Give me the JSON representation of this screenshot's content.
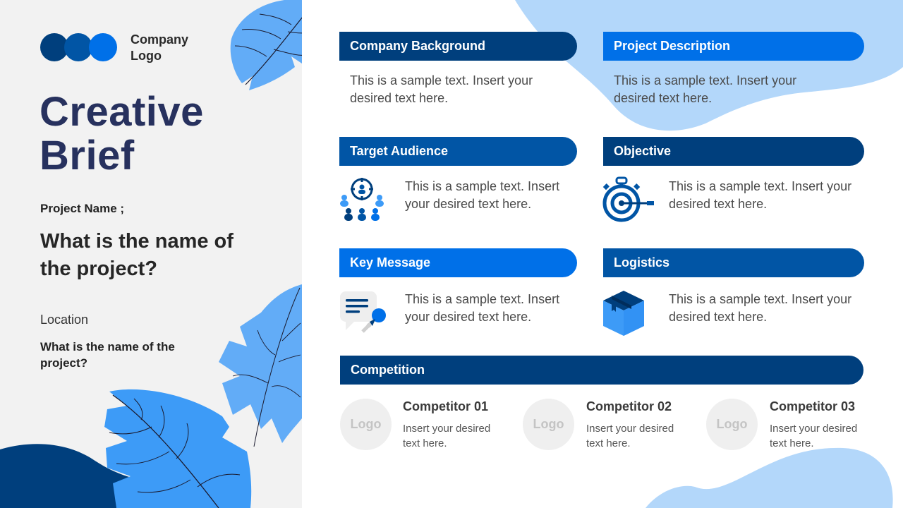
{
  "colors": {
    "navy": "#003f7d",
    "royal": "#0155a5",
    "bright": "#0070e8",
    "light_blob": "#b3d7fa",
    "leaf": "#3d9bf7",
    "leaf_light": "#62acf7",
    "title": "#27315e",
    "panel_bg": "#f2f2f2"
  },
  "sidebar": {
    "company_logo": "Company Logo",
    "title_line1": "Creative",
    "title_line2": "Brief",
    "project_name_label": "Project Name ;",
    "project_name_value": "What is the name of the project?",
    "location_label": "Location",
    "location_value": "What is the name of the project?"
  },
  "sections": {
    "company_background": {
      "title": "Company Background",
      "text": "This is a sample text. Insert your desired text here."
    },
    "project_description": {
      "title": "Project Description",
      "text": "This is a sample text. Insert your desired text here."
    },
    "target_audience": {
      "title": "Target Audience",
      "text": "This is a sample text. Insert your desired text here.",
      "icon": "target-audience-icon"
    },
    "objective": {
      "title": "Objective",
      "text": "This is a sample text. Insert your desired text here.",
      "icon": "stopwatch-target-icon"
    },
    "key_message": {
      "title": "Key Message",
      "text": "This is a sample text. Insert your desired text here.",
      "icon": "message-key-icon"
    },
    "logistics": {
      "title": "Logistics",
      "text": "This is a sample text. Insert your desired text here.",
      "icon": "package-box-icon"
    }
  },
  "competition": {
    "title": "Competition",
    "competitors": [
      {
        "logo": "Logo",
        "name": "Competitor 01",
        "desc": "Insert your desired text here."
      },
      {
        "logo": "Logo",
        "name": "Competitor 02",
        "desc": "Insert your desired text here."
      },
      {
        "logo": "Logo",
        "name": "Competitor 03",
        "desc": "Insert your desired text here."
      }
    ]
  }
}
